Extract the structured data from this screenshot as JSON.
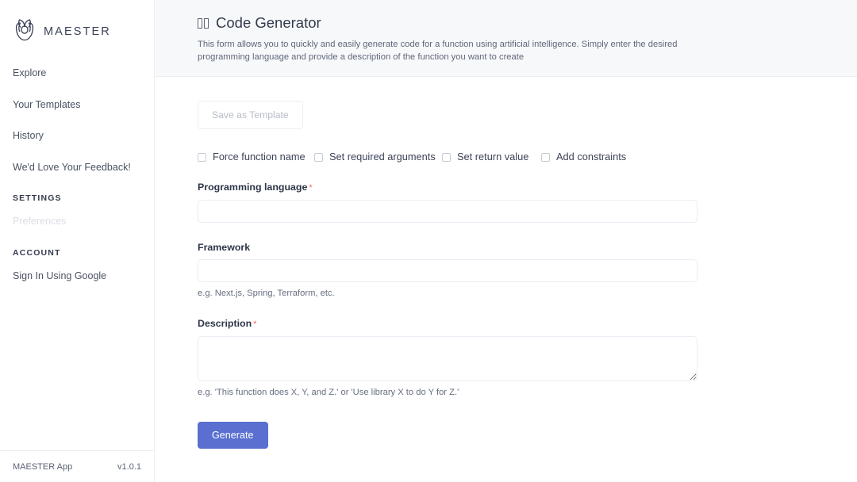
{
  "brand": {
    "name": "MAESTER",
    "logo_icon": "tulip-logo-icon"
  },
  "sidebar": {
    "items": [
      {
        "label": "Explore",
        "disabled": false
      },
      {
        "label": "Your Templates",
        "disabled": false
      },
      {
        "label": "History",
        "disabled": false
      },
      {
        "label": "We'd Love Your Feedback!",
        "disabled": false
      }
    ],
    "sections": [
      {
        "title": "SETTINGS",
        "items": [
          {
            "label": "Preferences",
            "disabled": true
          }
        ]
      },
      {
        "title": "ACCOUNT",
        "items": [
          {
            "label": "Sign In Using Google",
            "disabled": false
          }
        ]
      }
    ]
  },
  "footer": {
    "app_name": "MAESTER App",
    "version": "v1.0.1"
  },
  "header": {
    "title": "Code Generator",
    "title_icon": "missing-glyph-tofu-icon",
    "description": "This form allows you to quickly and easily generate code for a function using artificial intelligence. Simply enter the desired programming language and provide a description of the function you want to create"
  },
  "form": {
    "save_template_label": "Save as Template",
    "checkboxes": [
      {
        "label": "Force function name",
        "checked": false
      },
      {
        "label": "Set required arguments",
        "checked": false
      },
      {
        "label": "Set return value",
        "checked": false
      },
      {
        "label": "Add constraints",
        "checked": false
      }
    ],
    "fields": [
      {
        "label": "Programming language",
        "required": true,
        "required_mark": "*",
        "value": "",
        "placeholder": "",
        "help": ""
      },
      {
        "label": "Framework",
        "required": false,
        "required_mark": "",
        "value": "",
        "placeholder": "",
        "help": "e.g. Next.js, Spring, Terraform, etc."
      },
      {
        "label": "Description",
        "required": true,
        "required_mark": "*",
        "value": "",
        "placeholder": "",
        "help": "e.g. 'This function does X, Y, and Z.' or 'Use library X to do Y for Z.'"
      }
    ],
    "generate_label": "Generate"
  },
  "colors": {
    "accent": "#5a6fd0",
    "required": "#f4635c",
    "header_bg": "#f7f8fa",
    "border": "#ececf4",
    "text": "#3c4257"
  }
}
